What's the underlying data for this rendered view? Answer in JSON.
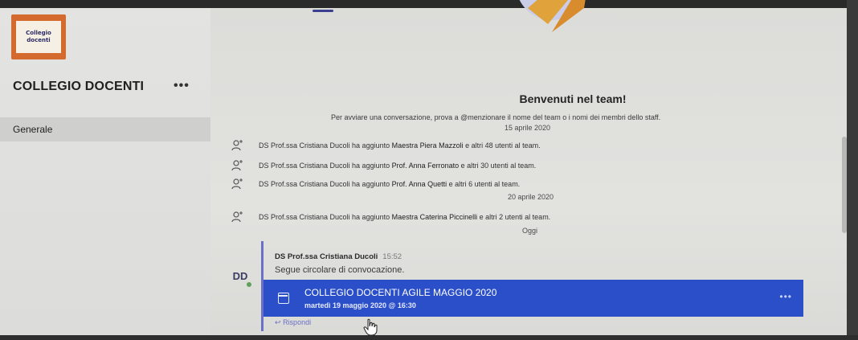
{
  "team": {
    "logo_line1": "Collegio",
    "logo_line2": "docenti",
    "name": "COLLEGIO DOCENTI",
    "more": "•••",
    "channels": [
      {
        "label": "Generale"
      }
    ]
  },
  "welcome": {
    "title": "Benvenuti nel team!",
    "subtitle": "Per avviare una conversazione, prova a @menzionare il nome del team o i nomi dei membri dello staff."
  },
  "timeline": {
    "dates": [
      "15 aprile 2020",
      "20 aprile 2020",
      "Oggi"
    ],
    "events": [
      {
        "actor": "DS Prof.ssa Cristiana Ducoli",
        "verb": " ha aggiunto ",
        "target": "Maestra Piera Mazzoli",
        "rest": " e altri 48 utenti al team."
      },
      {
        "actor": "DS Prof.ssa Cristiana Ducoli",
        "verb": " ha aggiunto ",
        "target": "Prof. Anna Ferronato",
        "rest": " e altri 30 utenti al team."
      },
      {
        "actor": "DS Prof.ssa Cristiana Ducoli",
        "verb": " ha aggiunto ",
        "target": "Prof. Anna Quetti",
        "rest": " e altri 6 utenti al team."
      },
      {
        "actor": "DS Prof.ssa Cristiana Ducoli",
        "verb": " ha aggiunto ",
        "target": "Maestra Caterina Piccinelli",
        "rest": " e altri 2 utenti al team."
      }
    ]
  },
  "message": {
    "avatar_initials": "DD",
    "author": "DS Prof.ssa Cristiana Ducoli",
    "time": "15:52",
    "body": "Segue circolare di convocazione.",
    "meeting": {
      "title": "COLLEGIO DOCENTI AGILE MAGGIO 2020",
      "datetime": "martedì 19 maggio 2020 @ 16:30",
      "more": "•••"
    },
    "reply_label": "Rispondi"
  },
  "colors": {
    "accent": "#6b6fc7",
    "meeting_bg": "#2b4fc9",
    "logo_orange": "#d46a2e",
    "presence_green": "#5fa05b"
  },
  "icons": {
    "add_user": "add-member-icon",
    "calendar": "calendar-icon",
    "reply": "reply-arrow-icon"
  }
}
